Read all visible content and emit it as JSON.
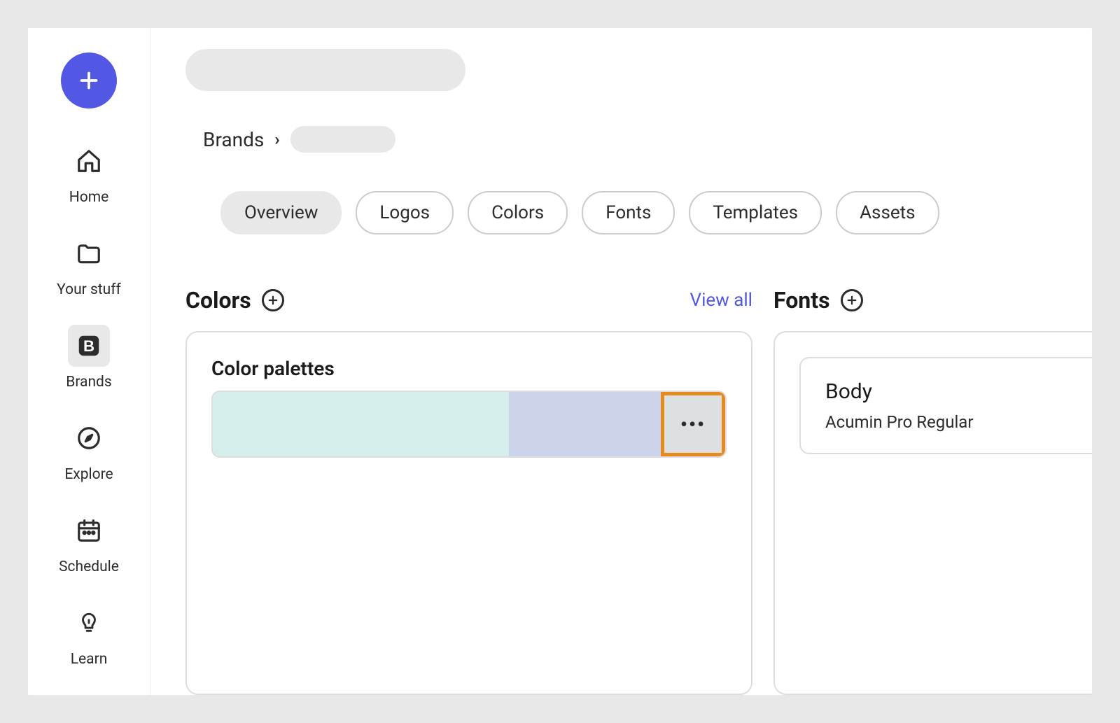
{
  "sidebar": {
    "items": [
      {
        "label": "Home",
        "icon": "home"
      },
      {
        "label": "Your stuff",
        "icon": "folder"
      },
      {
        "label": "Brands",
        "icon": "brand",
        "active": true
      },
      {
        "label": "Explore",
        "icon": "compass"
      },
      {
        "label": "Schedule",
        "icon": "calendar"
      },
      {
        "label": "Learn",
        "icon": "lightbulb"
      }
    ]
  },
  "breadcrumb": {
    "root": "Brands"
  },
  "tabs": [
    {
      "label": "Overview",
      "active": true
    },
    {
      "label": "Logos"
    },
    {
      "label": "Colors"
    },
    {
      "label": "Fonts"
    },
    {
      "label": "Templates"
    },
    {
      "label": "Assets"
    }
  ],
  "panels": {
    "colors": {
      "title": "Colors",
      "view_all": "View all",
      "subsection": "Color palettes",
      "palette": {
        "swatches": [
          "#d5eeec",
          "#ccd4ec"
        ]
      }
    },
    "fonts": {
      "title": "Fonts",
      "card": {
        "name": "Body",
        "value": "Acumin Pro Regular"
      }
    }
  }
}
